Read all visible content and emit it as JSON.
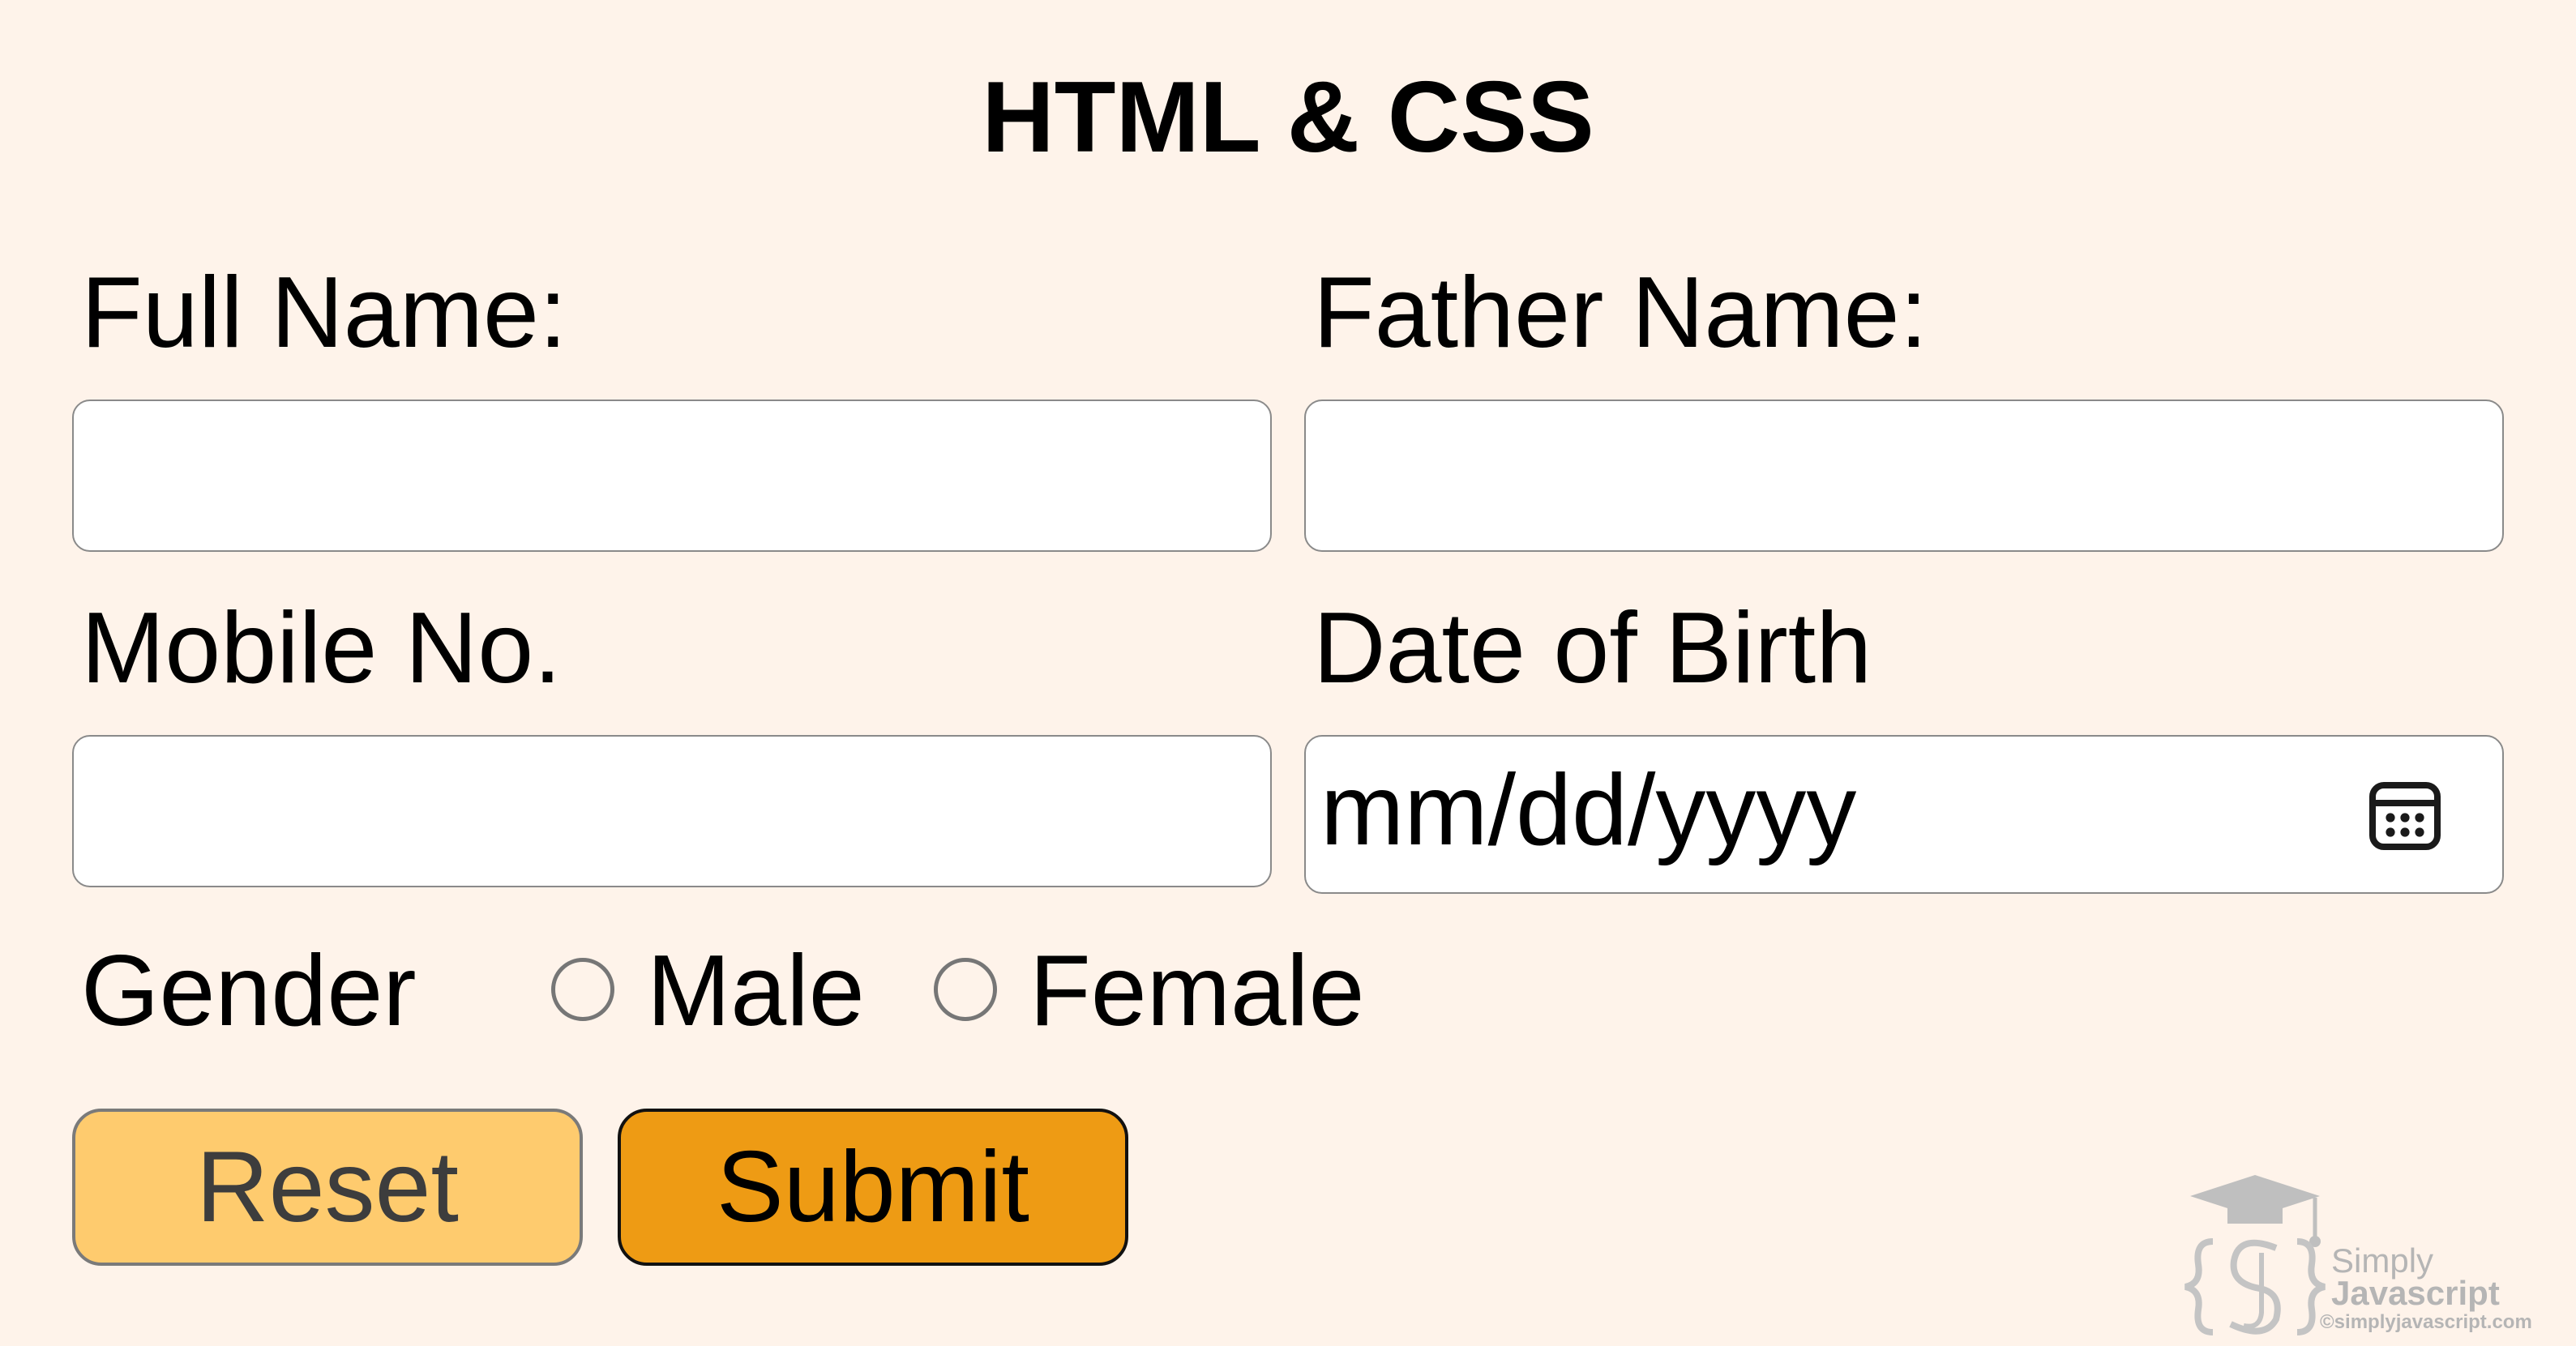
{
  "title": "HTML & CSS",
  "form": {
    "full_name": {
      "label": "Full Name:",
      "value": ""
    },
    "father_name": {
      "label": "Father Name:",
      "value": ""
    },
    "mobile": {
      "label": "Mobile No.",
      "value": ""
    },
    "dob": {
      "label": "Date of Birth",
      "placeholder": "mm/dd/yyyy",
      "icon": "calendar-icon"
    },
    "gender": {
      "label": "Gender",
      "options": [
        {
          "label": "Male",
          "checked": false
        },
        {
          "label": "Female",
          "checked": false
        }
      ]
    },
    "buttons": {
      "reset": "Reset",
      "submit": "Submit"
    }
  },
  "watermark": {
    "line1": "Simply",
    "line2": "Javascript",
    "line3": "©simplyjavascript.com"
  },
  "colors": {
    "background": "#fef3ea",
    "reset_button": "#fecb6e",
    "submit_button": "#ee9b14",
    "input_background": "#ffffff",
    "input_border": "#8a8a8a"
  }
}
